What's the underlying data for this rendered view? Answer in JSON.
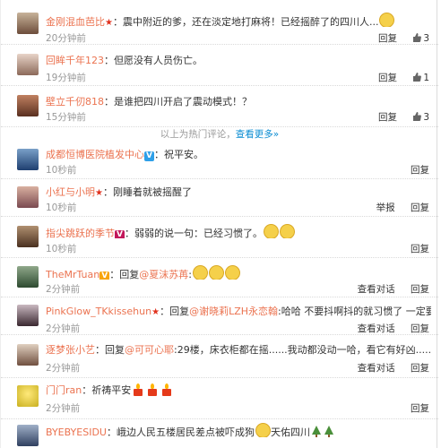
{
  "comments": [
    {
      "user": "金刚混血芭比",
      "message": "：震中附近的爹，还在淡定地打麻将！已经摇醉了的四川人...",
      "time": "20分钟前",
      "reply": "回复",
      "likes": "3"
    },
    {
      "user": "回眸千年123",
      "message": "：但愿没有人员伤亡。",
      "time": "19分钟前",
      "reply": "回复",
      "likes": "1"
    },
    {
      "user": "壁立千仞818",
      "message": "：是谁把四川开启了震动模式！？",
      "time": "15分钟前",
      "reply": "回复",
      "likes": "3"
    },
    {
      "user": "成都恒博医院植发中心",
      "message": "：祝平安。",
      "time": "10秒前",
      "reply": "回复"
    },
    {
      "user": "小红与小明",
      "message": "：刚睡着就被摇醒了",
      "time": "10秒前",
      "report": "举报",
      "reply": "回复"
    },
    {
      "user": "指尖跳跃的季节",
      "message": "：弱弱的说一句：已经习惯了。",
      "time": "10秒前",
      "reply": "回复"
    },
    {
      "user": "TheMrTuan",
      "message_prefix": "：回复",
      "mention": "@夏沫苏苒",
      "message": ":",
      "time": "2分钟前",
      "view": "查看对话",
      "reply": "回复"
    },
    {
      "user": "PinkGlow_TKkissehun",
      "message_prefix": "：回复",
      "mention": "@谢晓莉LZH永恋翰",
      "message": ":哈哈 不要抖啊抖的就习惯了 一定要跑出去",
      "time": "2分钟前",
      "view": "查看对话",
      "reply": "回复"
    },
    {
      "user": "逐梦张小艺",
      "message_prefix": "：回复",
      "mention": "@可可心耶",
      "message": ":29楼，床衣柜都在摇......我动都没动一哈，看它有好凶.....",
      "time": "2分钟前",
      "view": "查看对话",
      "reply": "回复"
    },
    {
      "user": "门门ran",
      "message": "：祈祷平安",
      "time": "2分钟前",
      "reply": "回复"
    },
    {
      "user": "BYEBYESIDU",
      "message": "：峨边人民五楼居民差点被吓成狗",
      "message2": "天佑四川",
      "time": "",
      "reply": ""
    }
  ],
  "hot_divider": {
    "text": "以上为热门评论，",
    "link": "查看更多»"
  },
  "colors": {
    "username": "#eb7350",
    "link": "#0a8cd2",
    "time": "#999999"
  }
}
